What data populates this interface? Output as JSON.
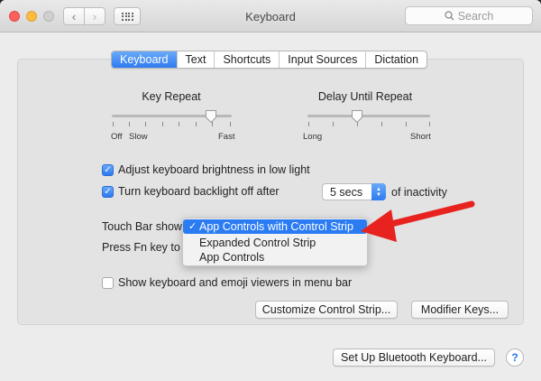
{
  "window": {
    "title": "Keyboard"
  },
  "search": {
    "placeholder": "Search"
  },
  "tabs": [
    {
      "label": "Keyboard",
      "active": true
    },
    {
      "label": "Text",
      "active": false
    },
    {
      "label": "Shortcuts",
      "active": false
    },
    {
      "label": "Input Sources",
      "active": false
    },
    {
      "label": "Dictation",
      "active": false
    }
  ],
  "key_repeat": {
    "label": "Key Repeat",
    "min_labels": [
      "Off",
      "Slow"
    ],
    "max_label": "Fast",
    "level": 0.8
  },
  "delay_until_repeat": {
    "label": "Delay Until Repeat",
    "min_label": "Long",
    "max_label": "Short",
    "level": 0.4
  },
  "options": {
    "brightness": {
      "label": "Adjust keyboard brightness in low light",
      "checked": true
    },
    "backlight": {
      "label": "Turn keyboard backlight off after",
      "checked": true,
      "value": "5 secs",
      "suffix": "of inactivity"
    },
    "emoji_viewers": {
      "label": "Show keyboard and emoji viewers in menu bar",
      "checked": false
    }
  },
  "touch_bar": {
    "label": "Touch Bar shows",
    "fn_label": "Press Fn key to",
    "menu": [
      {
        "label": "App Controls with Control Strip",
        "selected": true
      },
      {
        "label": "Expanded Control Strip",
        "selected": false
      },
      {
        "label": "App Controls",
        "selected": false
      }
    ]
  },
  "buttons": {
    "customize": "Customize Control Strip...",
    "modifier": "Modifier Keys...",
    "bluetooth": "Set Up Bluetooth Keyboard...",
    "help": "?"
  },
  "colors": {
    "accent": "#2b7cf3",
    "annotation_arrow": "#e8231f"
  }
}
